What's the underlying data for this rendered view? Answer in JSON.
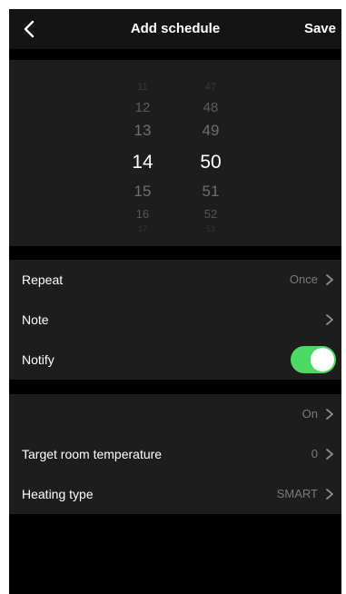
{
  "header": {
    "title": "Add schedule",
    "save_label": "Save"
  },
  "time_picker": {
    "hours": [
      "11",
      "12",
      "13",
      "14",
      "15",
      "16",
      "17"
    ],
    "minutes": [
      "47",
      "48",
      "49",
      "50",
      "51",
      "52",
      "53"
    ],
    "selected_hour": "14",
    "selected_minute": "50"
  },
  "settings": {
    "repeat": {
      "label": "Repeat",
      "value": "Once"
    },
    "note": {
      "label": "Note",
      "value": ""
    },
    "notify": {
      "label": "Notify",
      "enabled": true
    }
  },
  "device": {
    "power": {
      "label": "",
      "value": "On"
    },
    "target_temp": {
      "label": "Target room temperature",
      "value": "0"
    },
    "heating_type": {
      "label": "Heating type",
      "value": "SMART"
    }
  },
  "colors": {
    "toggle_on": "#4cd964",
    "row_background": "#1d1d1d",
    "secondary_text": "#7a7a7a"
  }
}
